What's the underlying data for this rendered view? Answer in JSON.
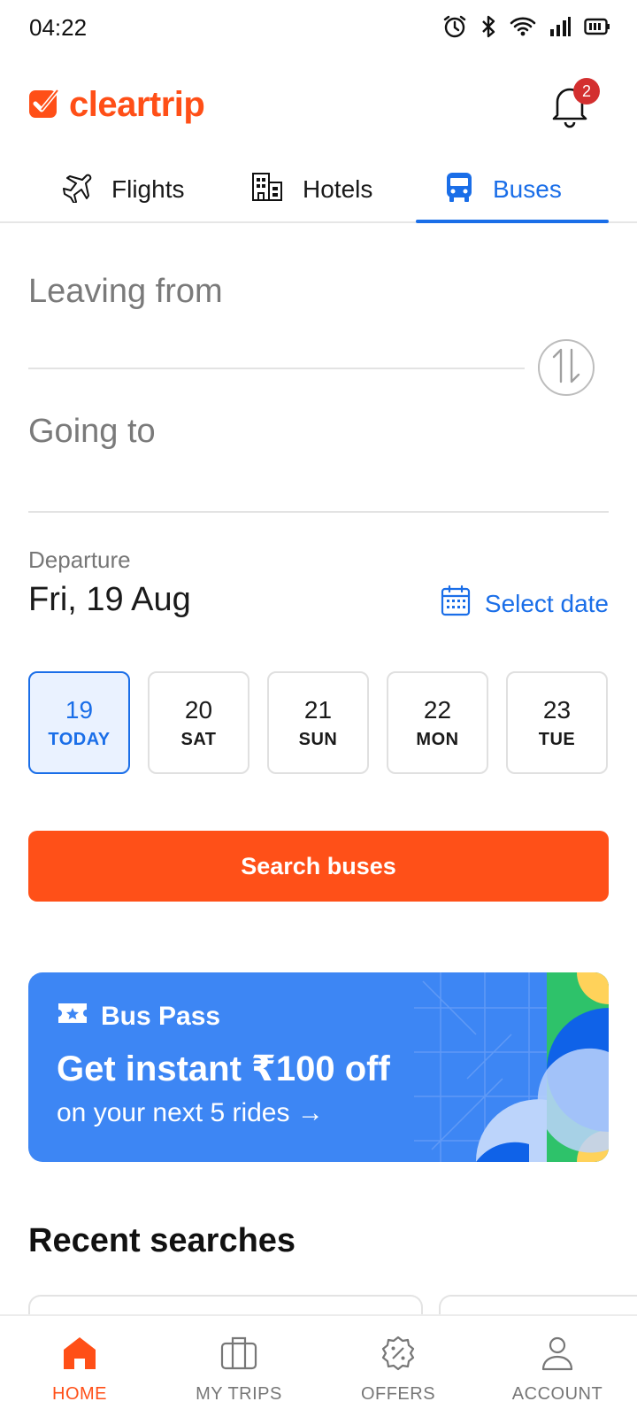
{
  "status_bar": {
    "time": "04:22"
  },
  "header": {
    "logo_text": "cleartrip",
    "notification_count": "2"
  },
  "tabs": [
    {
      "label": "Flights",
      "icon": "airplane-icon",
      "active": false
    },
    {
      "label": "Hotels",
      "icon": "building-icon",
      "active": false
    },
    {
      "label": "Buses",
      "icon": "bus-icon",
      "active": true
    }
  ],
  "search_form": {
    "from_placeholder": "Leaving from",
    "to_placeholder": "Going to",
    "departure_label": "Departure",
    "departure_value": "Fri, 19 Aug",
    "select_date_label": "Select date",
    "dates": [
      {
        "day": "19",
        "label": "TODAY",
        "selected": true
      },
      {
        "day": "20",
        "label": "SAT",
        "selected": false
      },
      {
        "day": "21",
        "label": "SUN",
        "selected": false
      },
      {
        "day": "22",
        "label": "MON",
        "selected": false
      },
      {
        "day": "23",
        "label": "TUE",
        "selected": false
      }
    ],
    "search_button": "Search buses"
  },
  "promo": {
    "title": "Bus Pass",
    "headline": "Get instant ₹100 off",
    "subtext": "on your next 5 rides →"
  },
  "recent": {
    "title": "Recent searches"
  },
  "bottom_nav": [
    {
      "label": "HOME",
      "icon": "home-icon",
      "active": true
    },
    {
      "label": "MY TRIPS",
      "icon": "suitcase-icon",
      "active": false
    },
    {
      "label": "OFFERS",
      "icon": "offer-badge-icon",
      "active": false
    },
    {
      "label": "ACCOUNT",
      "icon": "user-icon",
      "active": false
    }
  ],
  "colors": {
    "brand_orange": "#ff4f17",
    "accent_blue": "#1a6ee8",
    "promo_blue": "#3d86f4",
    "badge_red": "#d32f2f"
  }
}
